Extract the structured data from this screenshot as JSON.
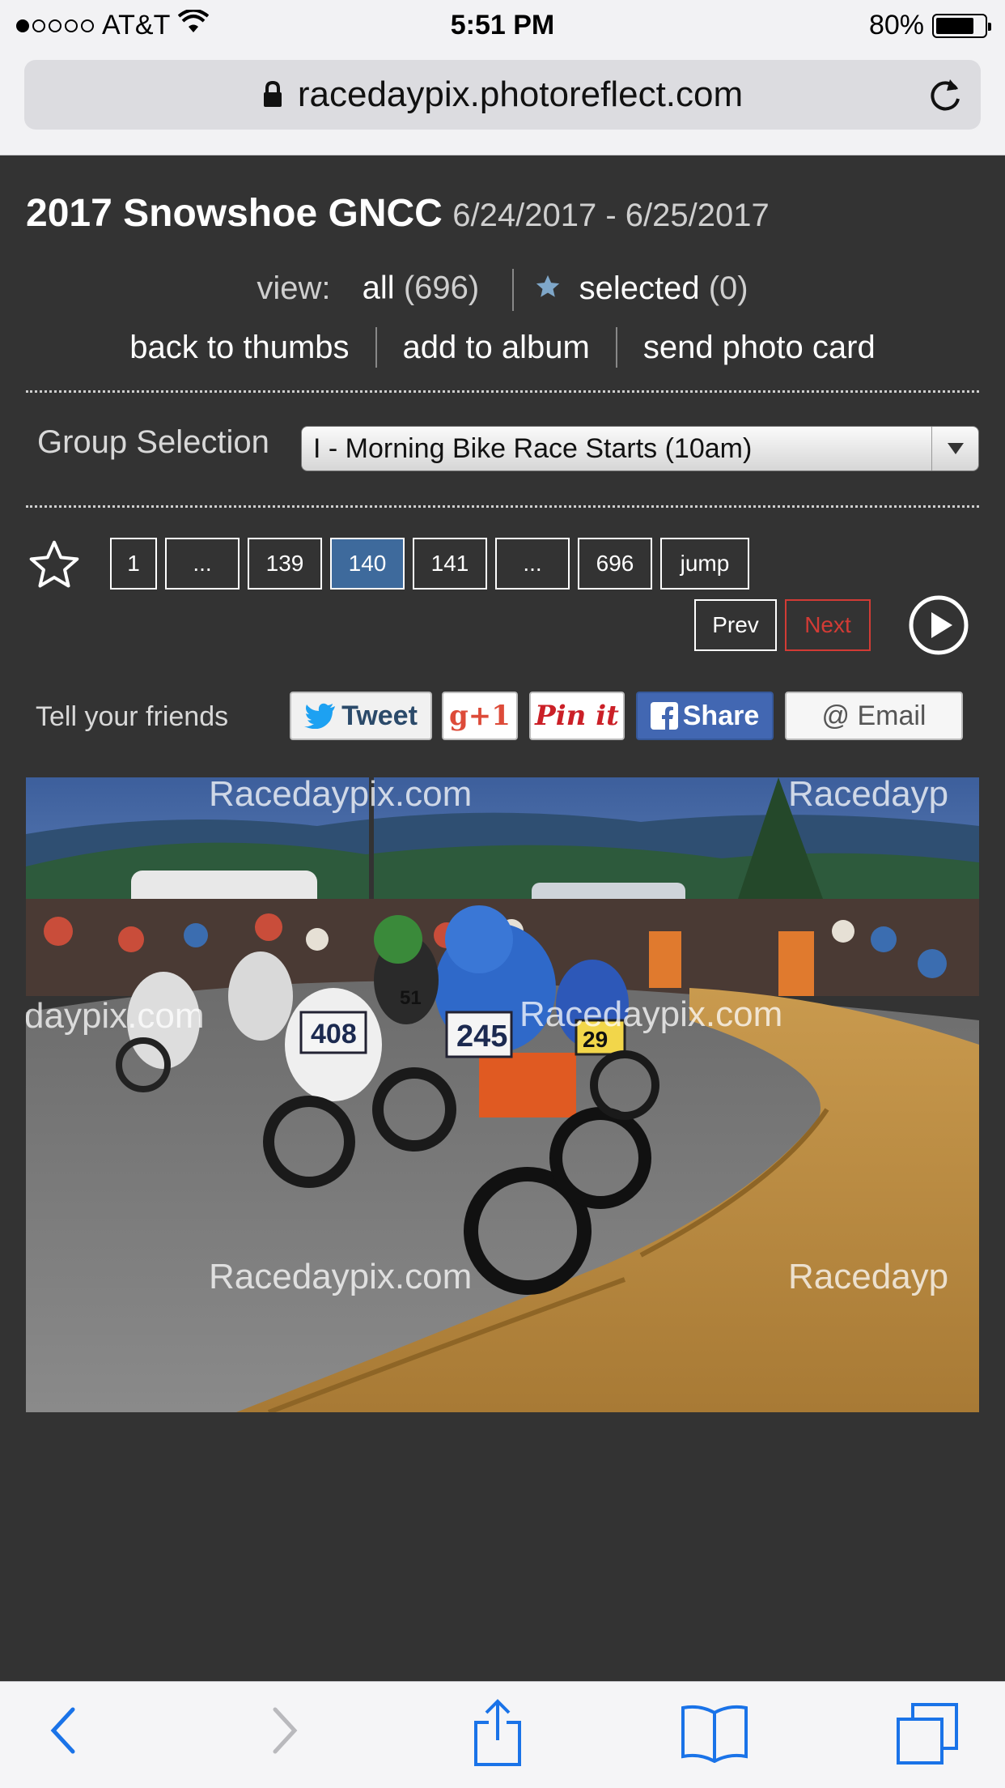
{
  "status_bar": {
    "carrier": "AT&T",
    "time": "5:51 PM",
    "battery_percent": "80%",
    "battery_level": 0.8,
    "signal_bars_filled": 1,
    "signal_bars_total": 5
  },
  "browser": {
    "url": "racedaypix.photoreflect.com"
  },
  "header": {
    "title": "2017 Snowshoe GNCC",
    "dates": "6/24/2017 - 6/25/2017"
  },
  "view": {
    "label": "view:",
    "all_label": "all",
    "all_count": "(696)",
    "selected_label": "selected",
    "selected_count": "(0)"
  },
  "links": {
    "back_to_thumbs": "back to thumbs",
    "add_to_album": "add to album",
    "send_photo_card": "send photo card"
  },
  "group": {
    "label": "Group Selection",
    "selected_value": "I - Morning Bike Race Starts (10am)"
  },
  "pager": {
    "pages": [
      "1",
      "...",
      "139",
      "140",
      "141",
      "...",
      "696",
      "jump"
    ],
    "current": "140",
    "prev_label": "Prev",
    "next_label": "Next"
  },
  "social": {
    "tell_label": "Tell your friends",
    "tweet": "Tweet",
    "gplus": "g+1",
    "pinit": "Pin it",
    "share": "Share",
    "email": "@ Email"
  },
  "photo": {
    "watermark": "Racedaypix.com",
    "watermark_cut": "Racedayp",
    "watermark_left": "daypix.com",
    "watermark_mid": "Racedaypix.com",
    "plates": [
      "408",
      "245",
      "51",
      "29"
    ]
  },
  "colors": {
    "page_bg": "#333333",
    "active_page": "#3e6a9c",
    "next_red": "#d23b35",
    "facebook": "#4267b2",
    "ios_blue": "#1a73e8"
  }
}
